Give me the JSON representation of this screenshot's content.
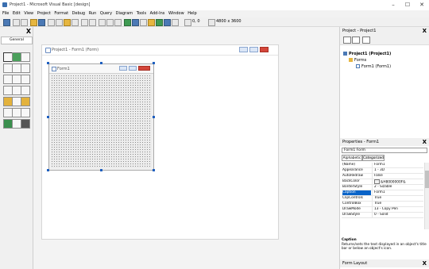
{
  "window": {
    "title": "Project1 - Microsoft Visual Basic [design]",
    "minimize": "–",
    "maximize": "☐",
    "close": "✕"
  },
  "menu": [
    "File",
    "Edit",
    "View",
    "Project",
    "Format",
    "Debug",
    "Run",
    "Query",
    "Diagram",
    "Tools",
    "Add-Ins",
    "Window",
    "Help"
  ],
  "toolbar": {
    "position": "0, 0",
    "size": "4800 x 3600"
  },
  "toolbox": {
    "title": "General",
    "close": "X"
  },
  "designer": {
    "title": "Project1 - Form1 (Form)",
    "form_caption": "Form1"
  },
  "project": {
    "title": "Project - Project1",
    "close": "X",
    "root": "Project1 (Project1)",
    "folder": "Forms",
    "item": "Form1 (Form1)"
  },
  "properties": {
    "title": "Properties - Form1",
    "close": "X",
    "object": "Form1 Form",
    "tabs": [
      "Alphabetic",
      "Categorized"
    ],
    "rows": [
      {
        "name": "(Name)",
        "value": "Form1"
      },
      {
        "name": "Appearance",
        "value": "1 - 3D"
      },
      {
        "name": "AutoRedraw",
        "value": "False"
      },
      {
        "name": "BackColor",
        "value": "&H8000000F&"
      },
      {
        "name": "BorderStyle",
        "value": "2 - Sizable"
      },
      {
        "name": "Caption",
        "value": "Form1"
      },
      {
        "name": "ClipControls",
        "value": "True"
      },
      {
        "name": "ControlBox",
        "value": "True"
      },
      {
        "name": "DrawMode",
        "value": "13 - Copy Pen"
      },
      {
        "name": "DrawStyle",
        "value": "0 - Solid"
      }
    ],
    "selected_row": "Caption",
    "description_title": "Caption",
    "description": "Returns/sets the text displayed in an object's title bar or below an object's icon."
  },
  "form_layout": {
    "title": "Form Layout",
    "close": "X"
  },
  "colors": {
    "accent": "#0a64c8",
    "close_button": "#d4463a"
  }
}
